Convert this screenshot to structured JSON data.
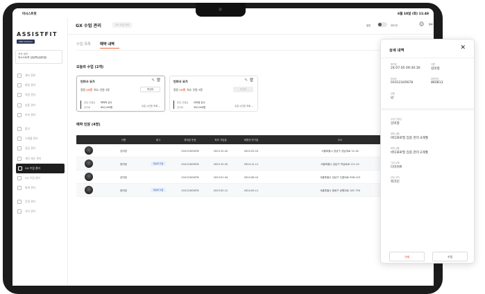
{
  "status_bar": {
    "left": "어시스트핏",
    "right": "6월 18일 (화) 11:48"
  },
  "sidebar": {
    "logo": "ASSISTFIT",
    "logo_badge": "CRM Solution",
    "center_label": "지적 센터",
    "center_name": "어시스트핏 강남핵심센터점",
    "items": [
      {
        "label": "센터 정보",
        "icon": "home-icon"
      },
      {
        "label": "회원 관리",
        "icon": "users-icon"
      },
      {
        "label": "직원 관리",
        "icon": "staff-icon"
      },
      {
        "label": "상품 관리",
        "icon": "box-icon"
      },
      {
        "label": "라커 관리",
        "icon": "locker-icon"
      },
      {
        "label": "출석",
        "icon": "check-icon"
      },
      {
        "label": "스케줄 관리",
        "icon": "calendar-icon"
      },
      {
        "label": "상담 관리",
        "icon": "headset-icon"
      },
      {
        "label": "개인 레슨 관리",
        "icon": "dumbbell-icon"
      },
      {
        "label": "GX 수업 관리",
        "icon": "gx-icon"
      },
      {
        "label": "GX 수업 관리",
        "icon": "swap-icon"
      },
      {
        "label": "통계 관리",
        "icon": "chart-icon"
      },
      {
        "label": "운영 관리",
        "icon": "gear-icon"
      },
      {
        "label": "기타 관리",
        "icon": "settings-icon"
      }
    ],
    "active_index": 9
  },
  "topbar": {
    "title": "GX 수업 관리",
    "chip": "GX 수업 관리",
    "toggle_left": "일반",
    "toggle_right": "어드민"
  },
  "tabs": [
    {
      "label": "수업 목록"
    },
    {
      "label": "예약 내역"
    }
  ],
  "today_title": "오늘의 수업 (2개)",
  "cards": [
    {
      "name": "빈야사 요가",
      "cap_label": "정원",
      "cap_value": "20명",
      "min_label": "최소 인원",
      "min_value": "3명",
      "button": "활성화",
      "instructor_label": "담당 선생님",
      "instructor": "박박박 강사",
      "price_label": "강사료",
      "price": "650,000원",
      "more": "수업 시간표 조회"
    },
    {
      "name": "빈야사 요가",
      "cap_label": "정원",
      "cap_value": "10명",
      "min_label": "최소 인원",
      "min_value": "3명",
      "button": "활성화",
      "instructor_label": "담당 선생님",
      "instructor": "이하정 강사",
      "price_label": "강사료",
      "price": "350,000원",
      "more": "수업 시간표 조회"
    }
  ],
  "reservations_title": "예약 인원 (4명)",
  "table": {
    "columns": [
      "이름",
      "태그",
      "휴대폰 번호",
      "최초 가입일",
      "회원권 만기일",
      "주소"
    ],
    "rows": [
      {
        "name": "김미정",
        "tag": "",
        "phone": "01012345678",
        "joined": "2023.10.20",
        "expires": "2025.03.10",
        "address": "서울특별시 강남구 강남대로 12-34"
      },
      {
        "name": "정미정",
        "tag": "재등록 회원",
        "phone": "01012345678",
        "joined": "2023.10.20",
        "expires": "2024.12.11",
        "address": "서울특별시 강남구 역삼로로 111-22"
      },
      {
        "name": "김미정",
        "tag": "",
        "phone": "01012345678",
        "joined": "2023.01.04",
        "expires": "2024.08.10",
        "address": "서울특별시 강남구 선릉대로 998-123"
      },
      {
        "name": "정미정",
        "tag": "재등록 회원",
        "phone": "01012345678",
        "joined": "2023.05.12",
        "expires": "2024.05.11",
        "address": "서울특별시 중랑구 공원대로 187-750"
      }
    ]
  },
  "panel": {
    "title": "상세 내역",
    "fields": [
      {
        "label": "예약일",
        "value": "24.07.05  09:30:30"
      },
      {
        "label": "이름",
        "value": "김미정"
      },
      {
        "label": "휴대폰",
        "value": "01012345678"
      },
      {
        "label": "회원번호",
        "value": "860813"
      },
      {
        "label": "성별",
        "value": "남"
      }
    ],
    "details": [
      {
        "label": "수업 선생님",
        "value": "강미정"
      },
      {
        "label": "결제 상품",
        "value": "바디프로필 집중 관리 4개월"
      },
      {
        "label": "회원 상품",
        "value": "바디프로필 집중 관리 2개월"
      },
      {
        "label": "가입 유형",
        "value": "다이어트"
      },
      {
        "label": "담당 코치",
        "value": "워크인"
      }
    ],
    "delete_label": "삭제",
    "edit_label": "수정"
  }
}
